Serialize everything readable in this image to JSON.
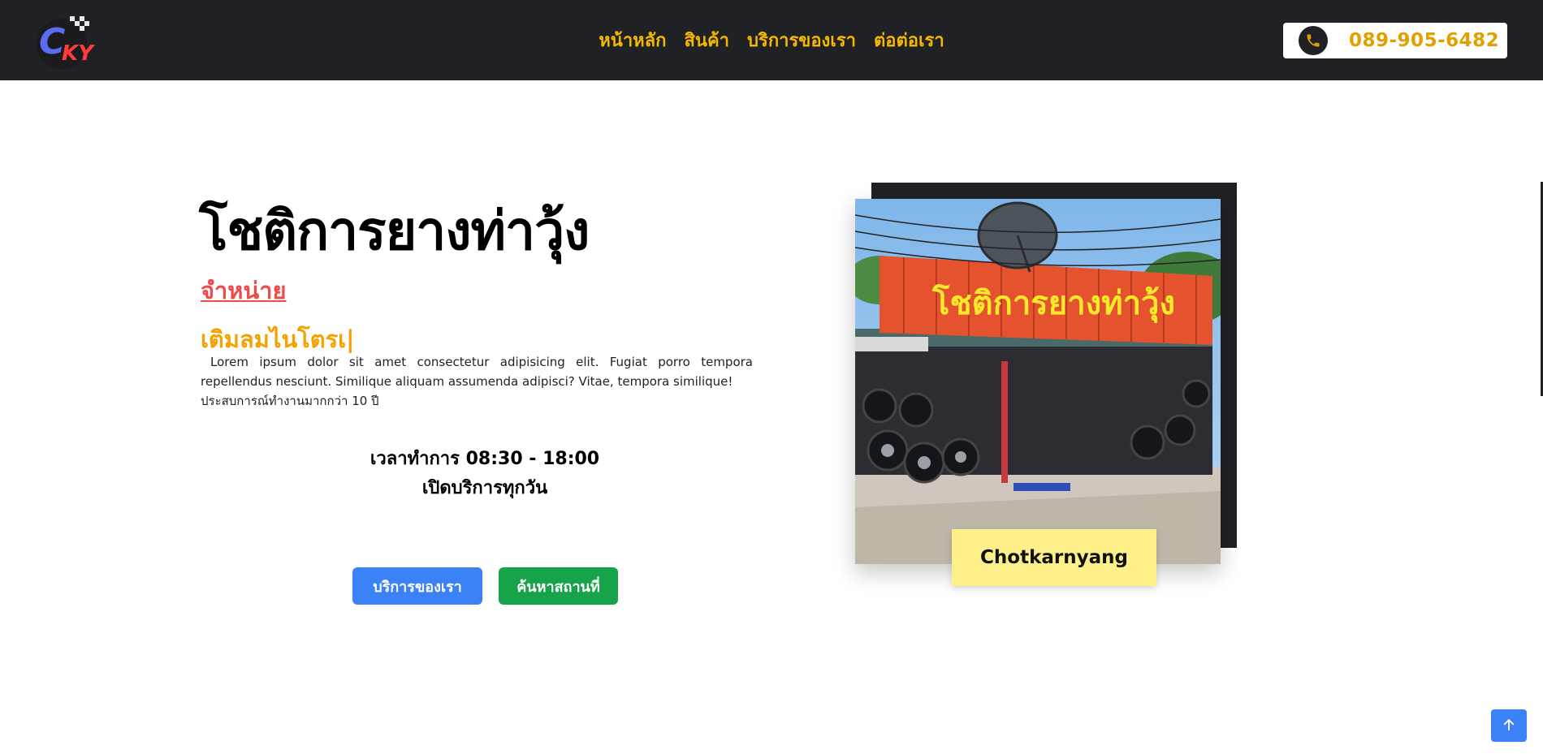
{
  "brand": {
    "logo_text": "CKY",
    "icon": "checkered-tire-logo"
  },
  "nav": {
    "items": [
      {
        "label": "หน้าหลัก"
      },
      {
        "label": "สินค้า"
      },
      {
        "label": "บริการของเรา"
      },
      {
        "label": "ต่อต่อเรา"
      }
    ]
  },
  "phone": {
    "number": "089-905-6482",
    "icon": "phone-icon"
  },
  "hero": {
    "title": "โชติการยางท่าวุ้ง",
    "subtitle_red": "จำหน่าย",
    "subtitle_yellow": "เติมลมไนโตรเ|",
    "description_line1": "Lorem ipsum dolor sit amet consectetur adipisicing elit. Fugiat porro tempora repellendus nesciunt. Similique aliquam assumenda adipisci? Vitae, tempora similique!",
    "description_line2": "ประสบการณ์ทำงานมากกว่า 10 ปี",
    "hours": "เวลาทำการ 08:30 - 18:00",
    "open_days": "เปิดบริการทุกวัน",
    "btn_services": "บริการของเรา",
    "btn_search": "ค้นหาสถานที่"
  },
  "photo": {
    "sign_text": "โชติการยางท่าวุ้ง",
    "caption": "Chotkarnyang",
    "colors": {
      "sign": "#e4522e",
      "sky": "#8fc3ee"
    }
  },
  "scroll_top": {
    "icon": "arrow-up-icon"
  },
  "colors": {
    "accent_yellow": "#f5b800",
    "dark": "#202124",
    "blue": "#3b82f6",
    "green": "#16a34a",
    "red": "#ef4b4b"
  }
}
